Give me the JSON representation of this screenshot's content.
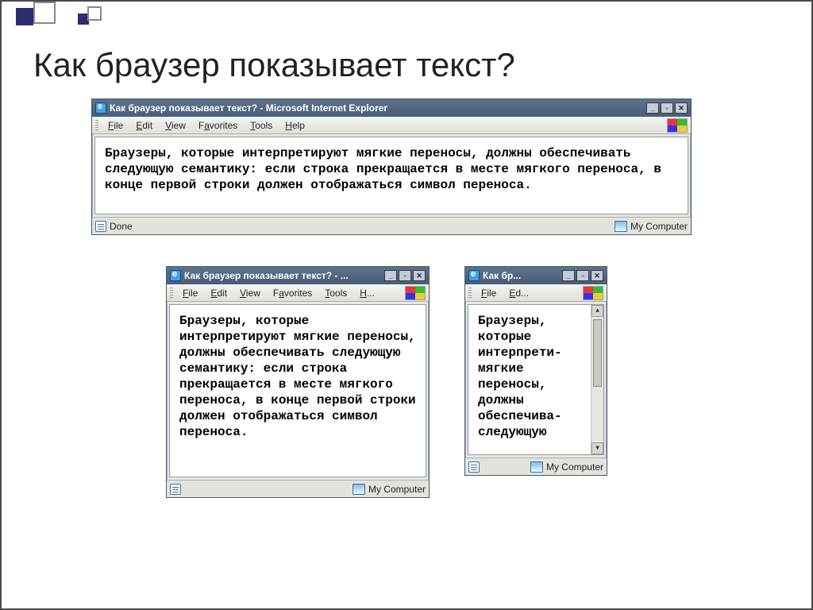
{
  "slide": {
    "title": "Как браузер показывает текст?"
  },
  "win1": {
    "title": "Как браузер показывает текст? - Microsoft Internet Explorer",
    "menu": {
      "file": "File",
      "edit": "Edit",
      "view": "View",
      "favorites": "Favorites",
      "tools": "Tools",
      "help": "Help"
    },
    "body": "Браузеры, которые интерпретируют мягкие переносы, должны обеспечивать следующую семантику: если строка прекращается в месте мягкого переноса, в конце первой строки должен отображаться символ переноса.",
    "status_left": "Done",
    "status_right": "My Computer"
  },
  "win2": {
    "title": "Как браузер показывает текст? - ...",
    "menu": {
      "file": "File",
      "edit": "Edit",
      "view": "View",
      "favorites": "Favorites",
      "tools": "Tools",
      "help": "H..."
    },
    "body": "Браузеры, которые интерпретируют мягкие переносы, должны обеспечивать следующую семантику: если строка прекращается в месте мягкого переноса, в конце первой строки должен отображаться символ переноса.",
    "status_right": "My Computer"
  },
  "win3": {
    "title": "Как бр...",
    "menu": {
      "file": "File",
      "edit": "Ed..."
    },
    "body": "Браузеры, которые интерпрети‑ мягкие переносы, должны обеспечива‑ следующую",
    "status_right": "My Computer"
  },
  "winctrl": {
    "min": "_",
    "max": "▫",
    "close": "✕"
  }
}
